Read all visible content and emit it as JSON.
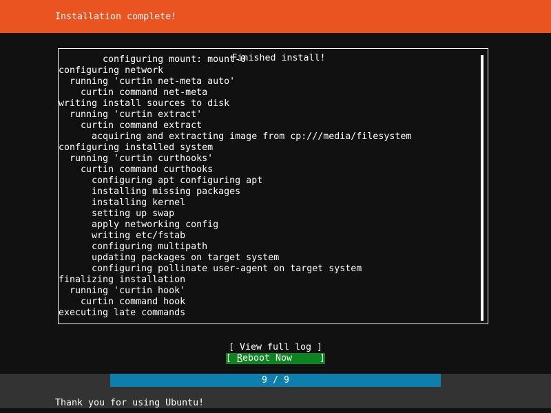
{
  "header": {
    "title": "Installation complete!",
    "background_color": "#e95420",
    "text_color": "#ffffff"
  },
  "log_panel": {
    "title": "Finished install!",
    "border_color": "#ffffff",
    "background_color": "#111111",
    "lines": [
      "        configuring mount: mount-0",
      "configuring network",
      "  running 'curtin net-meta auto'",
      "    curtin command net-meta",
      "writing install sources to disk",
      "  running 'curtin extract'",
      "    curtin command extract",
      "      acquiring and extracting image from cp:///media/filesystem",
      "configuring installed system",
      "  running 'curtin curthooks'",
      "    curtin command curthooks",
      "      configuring apt configuring apt",
      "      installing missing packages",
      "      installing kernel",
      "      setting up swap",
      "      apply networking config",
      "      writing etc/fstab",
      "      configuring multipath",
      "      updating packages on target system",
      "      configuring pollinate user-agent on target system",
      "finalizing installation",
      "  running 'curtin hook'",
      "    curtin command hook",
      "executing late commands"
    ],
    "scrollbar": {
      "name": "vertical-scrollbar",
      "thumb_color": "#ffffff"
    }
  },
  "buttons": [
    {
      "id": "view-full-log",
      "prefix": "[ ",
      "label": "View full log",
      "suffix": " ]",
      "selected": false,
      "accel_index": -1
    },
    {
      "id": "reboot-now",
      "prefix": "[ ",
      "label": "Reboot Now",
      "suffix": "     ]",
      "selected": true,
      "accel_index": 0,
      "highlight_color": "#0e8420"
    }
  ],
  "progress": {
    "label": "9 / 9",
    "current": 9,
    "total": 9,
    "percent": 100,
    "fill_color": "#0e7fad",
    "track_color": "#333333"
  },
  "footer": {
    "text": "Thank you for using Ubuntu!",
    "background_color": "#333333",
    "text_color": "#ffffff"
  }
}
